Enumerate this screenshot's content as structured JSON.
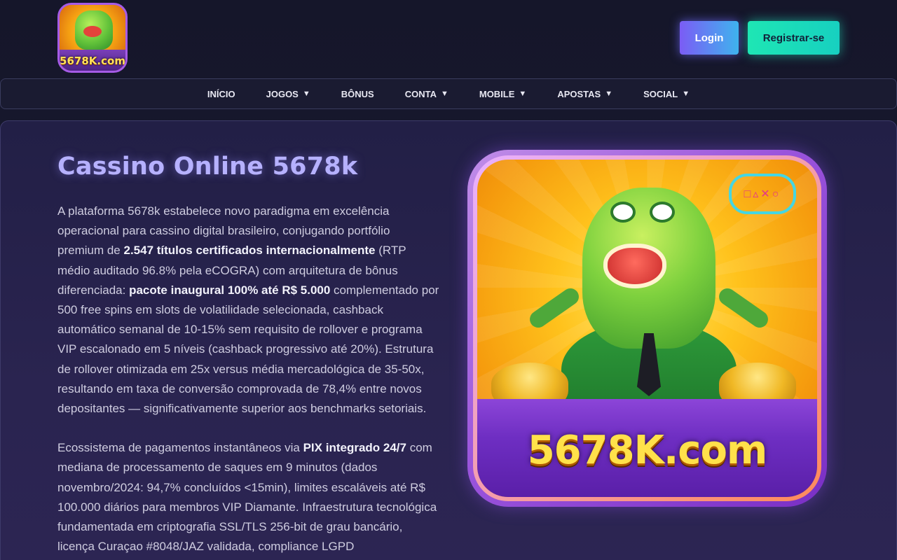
{
  "header": {
    "logo_text": "5678K.com",
    "login_label": "Login",
    "register_label": "Registrar-se"
  },
  "nav": {
    "items": [
      {
        "label": "INÍCIO",
        "has_dropdown": false
      },
      {
        "label": "JOGOS",
        "has_dropdown": true
      },
      {
        "label": "BÔNUS",
        "has_dropdown": false
      },
      {
        "label": "CONTA",
        "has_dropdown": true
      },
      {
        "label": "MOBILE",
        "has_dropdown": true
      },
      {
        "label": "APOSTAS",
        "has_dropdown": true
      },
      {
        "label": "SOCIAL",
        "has_dropdown": true
      }
    ],
    "caret": "▼"
  },
  "main": {
    "title": "Cassino Online 5678k",
    "p1": {
      "t1": "A plataforma 5678k estabelece novo paradigma em excelência operacional para cassino digital brasileiro, conjugando portfólio premium de ",
      "b1": "2.547 títulos certificados internacionalmente",
      "t2": " (RTP médio auditado 96.8% pela eCOGRA) com arquitetura de bônus diferenciada: ",
      "b2": "pacote inaugural 100% até R$ 5.000",
      "t3": " complementado por 500 free spins em slots de volatilidade selecionada, cashback automático semanal de 10-15% sem requisito de rollover e programa VIP escalonado em 5 níveis (cashback progressivo até 20%). Estrutura de rollover otimizada em 25x versus média mercadológica de 35-50x, resultando em taxa de conversão comprovada de 78,4% entre novos depositantes — significativamente superior aos benchmarks setoriais."
    },
    "p2": {
      "t1": "Ecossistema de pagamentos instantâneos via ",
      "b1": "PIX integrado 24/7",
      "t2": " com mediana de processamento de saques em 9 minutos (dados novembro/2024: 94,7% concluídos <15min), limites escaláveis até R$ 100.000 diários para membros VIP Diamante. Infraestrutura tecnológica fundamentada em criptografia SSL/TLS 256-bit de grau bancário, licença Curaçao #8048/JAZ validada, compliance LGPD"
    }
  },
  "hero": {
    "brand_text": "5678K.com",
    "controller_symbols": "□▵✕○"
  },
  "colors": {
    "background": "#191a2d",
    "title": "#b6b1ff",
    "login_gradient": [
      "#7b5cf5",
      "#3fb3ee"
    ],
    "register_gradient": [
      "#1ee6b4",
      "#17d0c0"
    ],
    "hero_border": "#9a54dc"
  }
}
